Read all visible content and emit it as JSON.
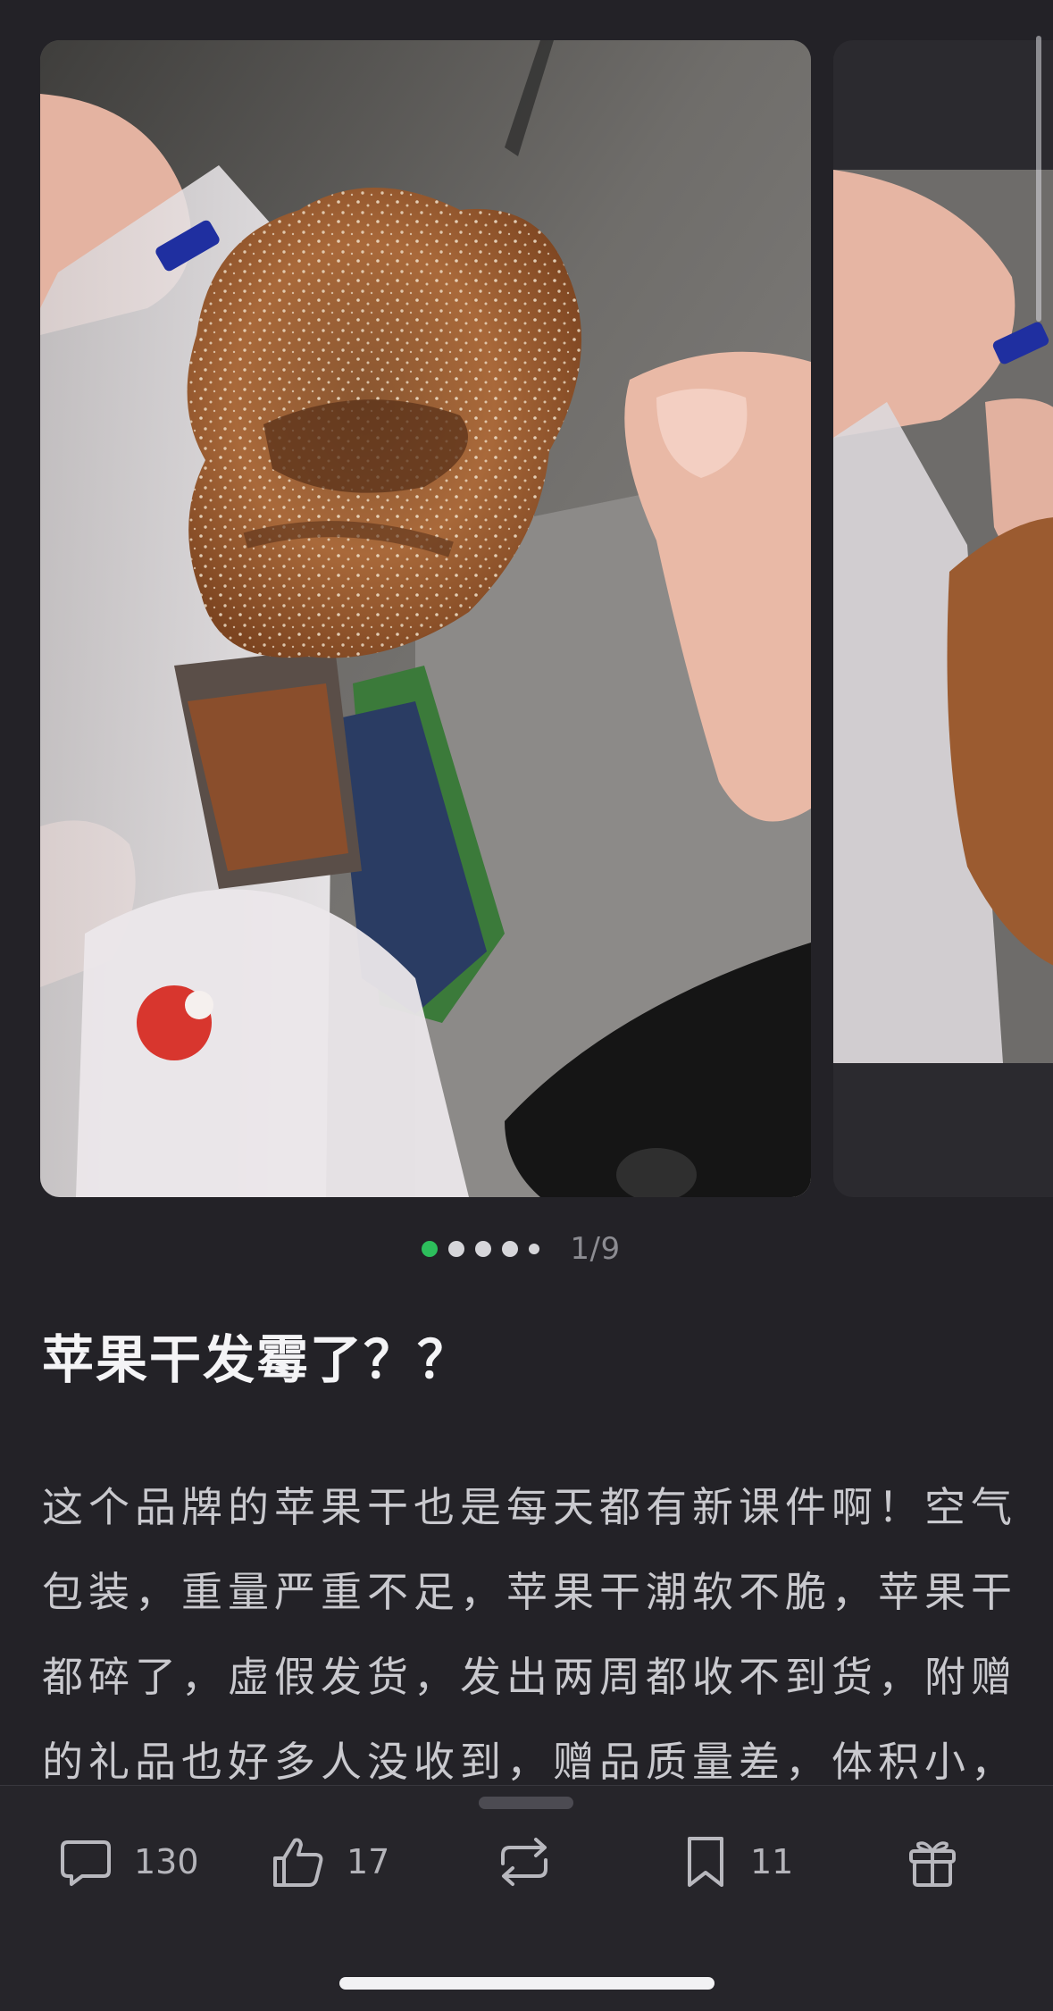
{
  "carousel": {
    "current_index": 1,
    "total": 9,
    "counter_text": "1/9",
    "dot_count": 5,
    "active_dot": 0
  },
  "post": {
    "title": "苹果干发霉了？？",
    "body": "这个品牌的苹果干也是每天都有新课件啊！空气包装，重量严重不足，苹果干潮软不脆，苹果干都碎了，虚假发货，发出两周都收不到货，附赠的礼品也好多人没收到，赠品质量差，体积小，"
  },
  "actions": {
    "comment": {
      "icon": "comment-icon",
      "count": "130"
    },
    "like": {
      "icon": "thumbs-up-icon",
      "count": "17"
    },
    "repost": {
      "icon": "repost-icon"
    },
    "bookmark": {
      "icon": "bookmark-icon",
      "count": "11"
    },
    "gift": {
      "icon": "gift-icon"
    }
  },
  "colors": {
    "background": "#232227",
    "active_dot": "#2dbe5c",
    "text_primary": "#f4f4f6",
    "text_secondary": "#c9c9ce"
  }
}
